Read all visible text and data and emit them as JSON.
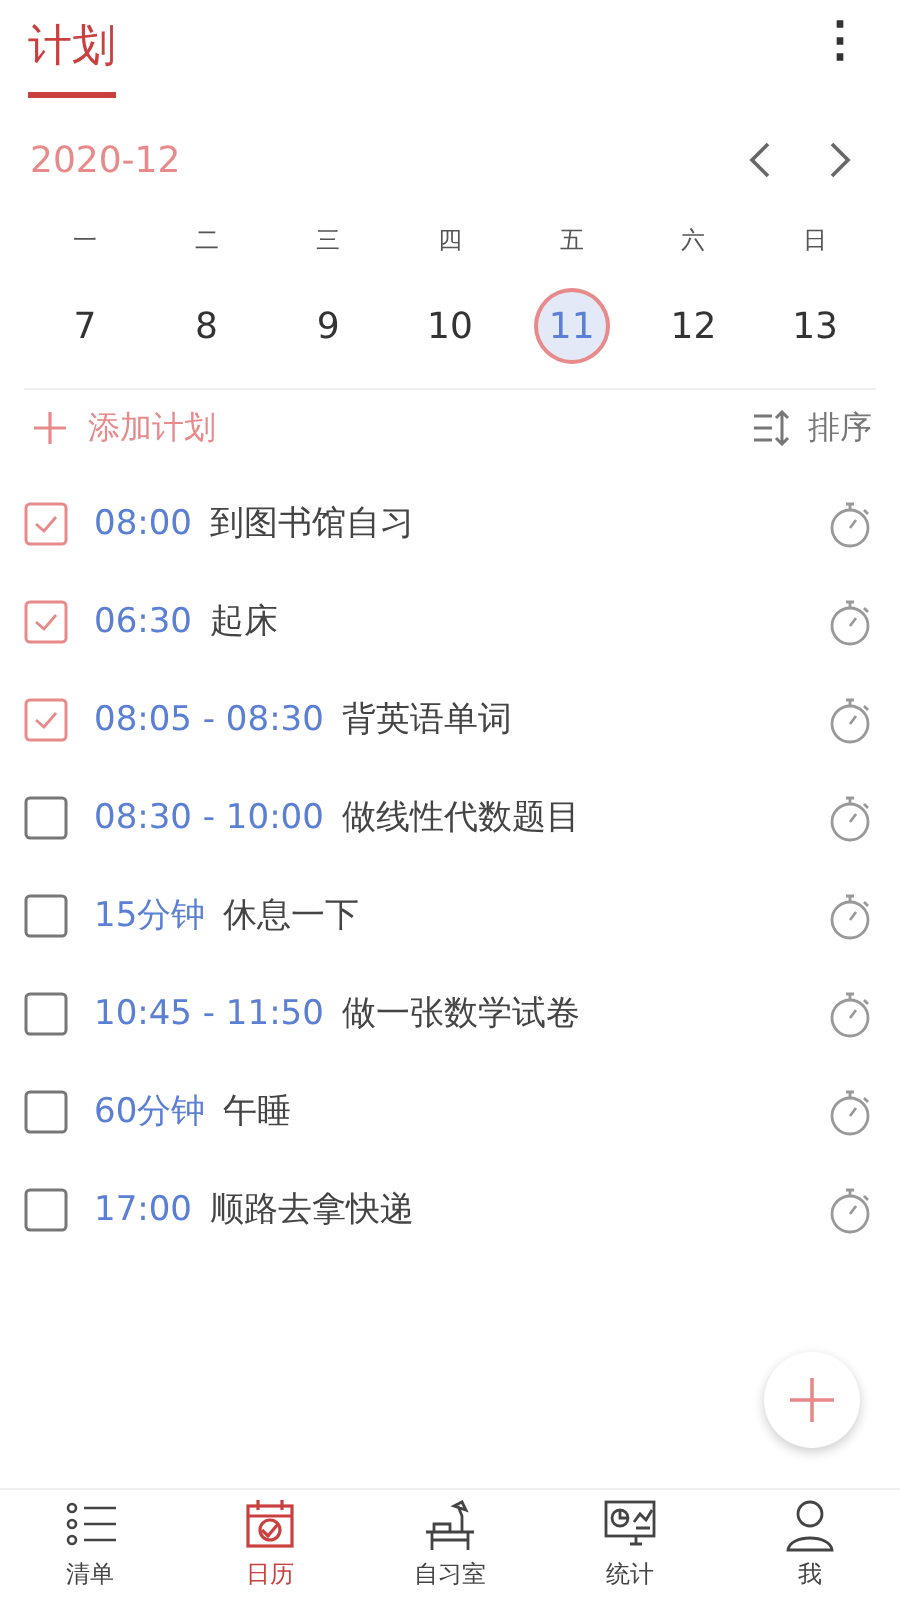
{
  "header": {
    "title": "计划",
    "menu_icon": "⋮"
  },
  "calendar": {
    "month": "2020-12",
    "weekdays": [
      "一",
      "二",
      "三",
      "四",
      "五",
      "六",
      "日"
    ],
    "days": [
      {
        "label": "7",
        "selected": false
      },
      {
        "label": "8",
        "selected": false
      },
      {
        "label": "9",
        "selected": false
      },
      {
        "label": "10",
        "selected": false
      },
      {
        "label": "11",
        "selected": true
      },
      {
        "label": "12",
        "selected": false
      },
      {
        "label": "13",
        "selected": false
      }
    ]
  },
  "actions": {
    "add": "添加计划",
    "sort": "排序"
  },
  "tasks": [
    {
      "checked": true,
      "time": "08:00",
      "title": "到图书馆自习"
    },
    {
      "checked": true,
      "time": "06:30",
      "title": "起床"
    },
    {
      "checked": true,
      "time": "08:05 - 08:30",
      "title": "背英语单词"
    },
    {
      "checked": false,
      "time": "08:30 - 10:00",
      "title": "做线性代数题目"
    },
    {
      "checked": false,
      "time": "15分钟",
      "title": "休息一下"
    },
    {
      "checked": false,
      "time": "10:45 - 11:50",
      "title": "做一张数学试卷"
    },
    {
      "checked": false,
      "time": "60分钟",
      "title": "午睡"
    },
    {
      "checked": false,
      "time": "17:00",
      "title": "顺路去拿快递"
    }
  ],
  "nav": [
    {
      "kind": "list",
      "label": "清单",
      "selected": false
    },
    {
      "kind": "calendar",
      "label": "日历",
      "selected": true
    },
    {
      "kind": "desk",
      "label": "自习室",
      "selected": false
    },
    {
      "kind": "stats",
      "label": "统计",
      "selected": false
    },
    {
      "kind": "user",
      "label": "我",
      "selected": false
    }
  ]
}
